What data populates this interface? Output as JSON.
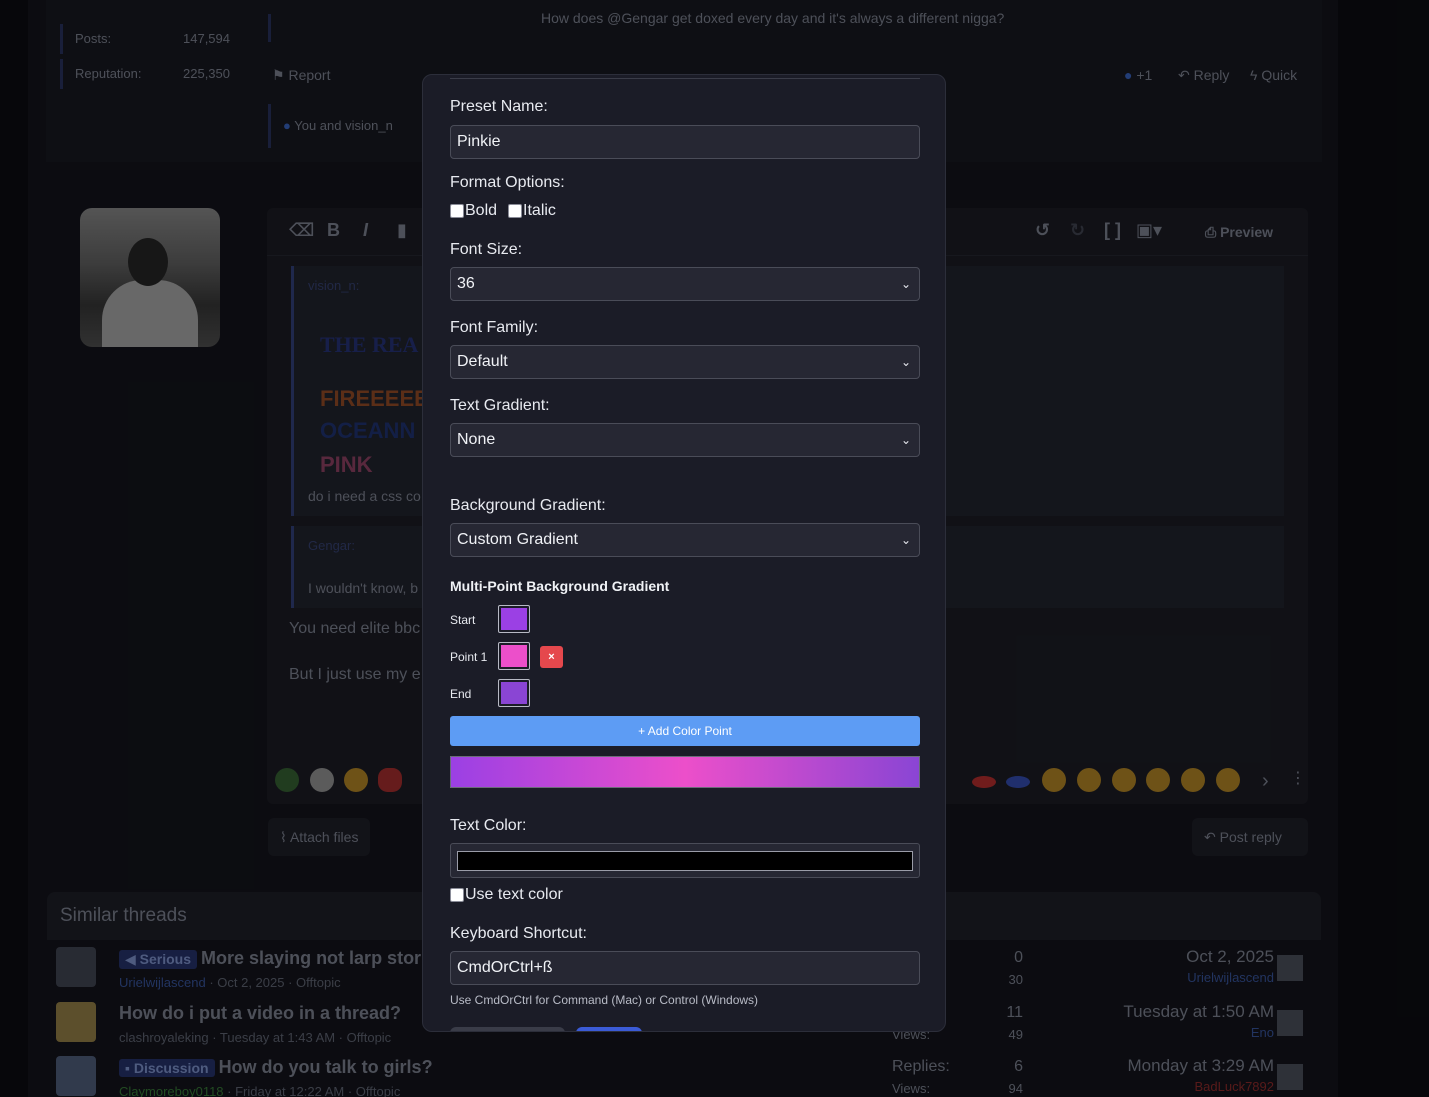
{
  "background": {
    "post_top_text": "How does  @Gengar get doxed every day and it's always a different nigga?",
    "stats": [
      {
        "label": "Posts:",
        "value": "147,594"
      },
      {
        "label": "Reputation:",
        "value": "225,350"
      }
    ],
    "report_label": "Report",
    "plus_one_label": "+1",
    "reply_label": "Reply",
    "quick_label": "Quick",
    "likes_text": "You and vision_n",
    "editor": {
      "preview_label": "Preview",
      "quote1_author": "vision_n:",
      "quote1_lines": [
        "THE REA",
        "FIREEEEE",
        "OCEANN",
        "PINK"
      ],
      "quote1_text": "do i need a css co",
      "quote2_author": "Gengar:",
      "quote2_text": "I wouldn't know, b",
      "body_line1": "You need elite bbc",
      "body_line2": "But I just use my e"
    },
    "attach_label": "Attach files",
    "post_reply_label": "Post reply",
    "similar_title": "Similar threads",
    "threads": [
      {
        "tag": "Serious",
        "title": "More slaying not larp stor",
        "user": "Urielwijlascend",
        "meta": " · Oct 2, 2025 · Offtopic",
        "replies": "0",
        "views": "30",
        "date": "Oct 2, 2025",
        "last_user": "Urielwijlascend"
      },
      {
        "tag": "",
        "title": "How do i put a video in a thread?",
        "user": "clashroyaleking",
        "meta": " · Tuesday at 1:43 AM · Offtopic",
        "replies": "11",
        "views": "49",
        "views_label": "Views:",
        "date": "Tuesday at 1:50 AM",
        "last_user": "Eno"
      },
      {
        "tag": "Discussion",
        "title": "How do you talk to girls?",
        "user": "Claymoreboy0118",
        "meta": " · Friday at 12:22 AM · Offtopic",
        "replies_label": "Replies:",
        "replies": "6",
        "views_label": "Views:",
        "views": "94",
        "date": "Monday at 3:29 AM",
        "last_user": "BadLuck7892"
      }
    ]
  },
  "modal": {
    "preset_name_label": "Preset Name:",
    "preset_name_value": "Pinkie",
    "format_label": "Format Options:",
    "bold_label": "Bold",
    "italic_label": "Italic",
    "font_size_label": "Font Size:",
    "font_size_value": "36",
    "font_family_label": "Font Family:",
    "font_family_value": "Default",
    "text_gradient_label": "Text Gradient:",
    "text_gradient_value": "None",
    "bg_gradient_label": "Background Gradient:",
    "bg_gradient_value": "Custom Gradient",
    "multipoint_title": "Multi-Point Background Gradient",
    "points": [
      {
        "label": "Start",
        "color": "#9b40e4",
        "removable": false
      },
      {
        "label": "Point 1",
        "color": "#ec4fca",
        "removable": true
      },
      {
        "label": "End",
        "color": "#8a45d4",
        "removable": false
      }
    ],
    "remove_glyph": "×",
    "add_point_label": "+ Add Color Point",
    "text_color_label": "Text Color:",
    "text_color_value": "#000000",
    "use_text_color_label": "Use text color",
    "shortcut_label": "Keyboard Shortcut:",
    "shortcut_value": "CmdOrCtrl+ß",
    "shortcut_hint": "Use CmdOrCtrl for Command (Mac) or Control (Windows)"
  }
}
